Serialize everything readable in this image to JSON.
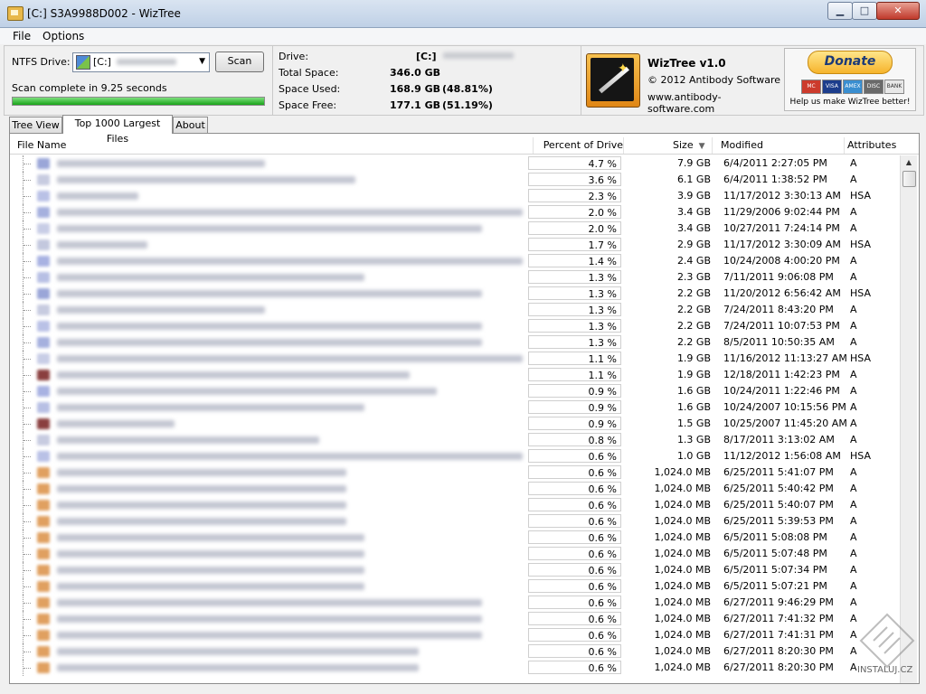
{
  "window": {
    "title": "[C:] S3A9988D002  - WizTree",
    "min": "▁",
    "max": "□",
    "close": "✕"
  },
  "menu": {
    "file": "File",
    "options": "Options"
  },
  "drive_panel": {
    "ntfs_label": "NTFS Drive:",
    "drive_value": "[C:]",
    "scan_label": "Scan",
    "status": "Scan complete in 9.25 seconds",
    "progress": 1.0
  },
  "info": {
    "drive_label": "Drive:",
    "drive_value": "[C:]",
    "total_label": "Total Space:",
    "total_value": "346.0 GB",
    "used_label": "Space Used:",
    "used_value": "168.9 GB",
    "used_pct": "(48.81%)",
    "free_label": "Space Free:",
    "free_value": "177.1 GB",
    "free_pct": "(51.19%)"
  },
  "about": {
    "name": "WizTree v1.0",
    "copyright": "© 2012 Antibody Software",
    "url": "www.antibody-software.com"
  },
  "donate": {
    "label": "Donate",
    "note": "Help us make WizTree better!",
    "cards": [
      "MC",
      "VISA",
      "AMEX",
      "DISC",
      "BANK"
    ]
  },
  "tabs": [
    "Tree View",
    "Top 1000 Largest Files",
    "About"
  ],
  "columns": {
    "name": "File Name",
    "pct": "Percent of Drive",
    "size": "Size",
    "modified": "Modified",
    "attributes": "Attributes"
  },
  "rows": [
    {
      "pct": "4.7 %",
      "size": "7.9 GB",
      "mod": "6/4/2011 2:27:05 PM",
      "attr": "A"
    },
    {
      "pct": "3.6 %",
      "size": "6.1 GB",
      "mod": "6/4/2011 1:38:52 PM",
      "attr": "A"
    },
    {
      "pct": "2.3 %",
      "size": "3.9 GB",
      "mod": "11/17/2012 3:30:13 AM",
      "attr": "HSA"
    },
    {
      "pct": "2.0 %",
      "size": "3.4 GB",
      "mod": "11/29/2006 9:02:44 PM",
      "attr": "A"
    },
    {
      "pct": "2.0 %",
      "size": "3.4 GB",
      "mod": "10/27/2011 7:24:14 PM",
      "attr": "A"
    },
    {
      "pct": "1.7 %",
      "size": "2.9 GB",
      "mod": "11/17/2012 3:30:09 AM",
      "attr": "HSA"
    },
    {
      "pct": "1.4 %",
      "size": "2.4 GB",
      "mod": "10/24/2008 4:00:20 PM",
      "attr": "A"
    },
    {
      "pct": "1.3 %",
      "size": "2.3 GB",
      "mod": "7/11/2011 9:06:08 PM",
      "attr": "A"
    },
    {
      "pct": "1.3 %",
      "size": "2.2 GB",
      "mod": "11/20/2012 6:56:42 AM",
      "attr": "HSA"
    },
    {
      "pct": "1.3 %",
      "size": "2.2 GB",
      "mod": "7/24/2011 8:43:20 PM",
      "attr": "A"
    },
    {
      "pct": "1.3 %",
      "size": "2.2 GB",
      "mod": "7/24/2011 10:07:53 PM",
      "attr": "A"
    },
    {
      "pct": "1.3 %",
      "size": "2.2 GB",
      "mod": "8/5/2011 10:50:35 AM",
      "attr": "A"
    },
    {
      "pct": "1.1 %",
      "size": "1.9 GB",
      "mod": "11/16/2012 11:13:27 AM",
      "attr": "HSA"
    },
    {
      "pct": "1.1 %",
      "size": "1.9 GB",
      "mod": "12/18/2011 1:42:23 PM",
      "attr": "A"
    },
    {
      "pct": "0.9 %",
      "size": "1.6 GB",
      "mod": "10/24/2011 1:22:46 PM",
      "attr": "A"
    },
    {
      "pct": "0.9 %",
      "size": "1.6 GB",
      "mod": "10/24/2007 10:15:56 PM",
      "attr": "A"
    },
    {
      "pct": "0.9 %",
      "size": "1.5 GB",
      "mod": "10/25/2007 11:45:20 AM",
      "attr": "A"
    },
    {
      "pct": "0.8 %",
      "size": "1.3 GB",
      "mod": "8/17/2011 3:13:02 AM",
      "attr": "A"
    },
    {
      "pct": "0.6 %",
      "size": "1.0 GB",
      "mod": "11/12/2012 1:56:08 AM",
      "attr": "HSA"
    },
    {
      "pct": "0.6 %",
      "size": "1,024.0 MB",
      "mod": "6/25/2011 5:41:07 PM",
      "attr": "A"
    },
    {
      "pct": "0.6 %",
      "size": "1,024.0 MB",
      "mod": "6/25/2011 5:40:42 PM",
      "attr": "A"
    },
    {
      "pct": "0.6 %",
      "size": "1,024.0 MB",
      "mod": "6/25/2011 5:40:07 PM",
      "attr": "A"
    },
    {
      "pct": "0.6 %",
      "size": "1,024.0 MB",
      "mod": "6/25/2011 5:39:53 PM",
      "attr": "A"
    },
    {
      "pct": "0.6 %",
      "size": "1,024.0 MB",
      "mod": "6/5/2011 5:08:08 PM",
      "attr": "A"
    },
    {
      "pct": "0.6 %",
      "size": "1,024.0 MB",
      "mod": "6/5/2011 5:07:48 PM",
      "attr": "A"
    },
    {
      "pct": "0.6 %",
      "size": "1,024.0 MB",
      "mod": "6/5/2011 5:07:34 PM",
      "attr": "A"
    },
    {
      "pct": "0.6 %",
      "size": "1,024.0 MB",
      "mod": "6/5/2011 5:07:21 PM",
      "attr": "A"
    },
    {
      "pct": "0.6 %",
      "size": "1,024.0 MB",
      "mod": "6/27/2011 9:46:29 PM",
      "attr": "A"
    },
    {
      "pct": "0.6 %",
      "size": "1,024.0 MB",
      "mod": "6/27/2011 7:41:32 PM",
      "attr": "A"
    },
    {
      "pct": "0.6 %",
      "size": "1,024.0 MB",
      "mod": "6/27/2011 7:41:31 PM",
      "attr": "A"
    },
    {
      "pct": "0.6 %",
      "size": "1,024.0 MB",
      "mod": "6/27/2011 8:20:30 PM",
      "attr": "A"
    },
    {
      "pct": "0.6 %",
      "size": "1,024.0 MB",
      "mod": "6/27/2011 8:20:30 PM",
      "attr": "A"
    }
  ],
  "watermark": "INSTALUJ.CZ"
}
